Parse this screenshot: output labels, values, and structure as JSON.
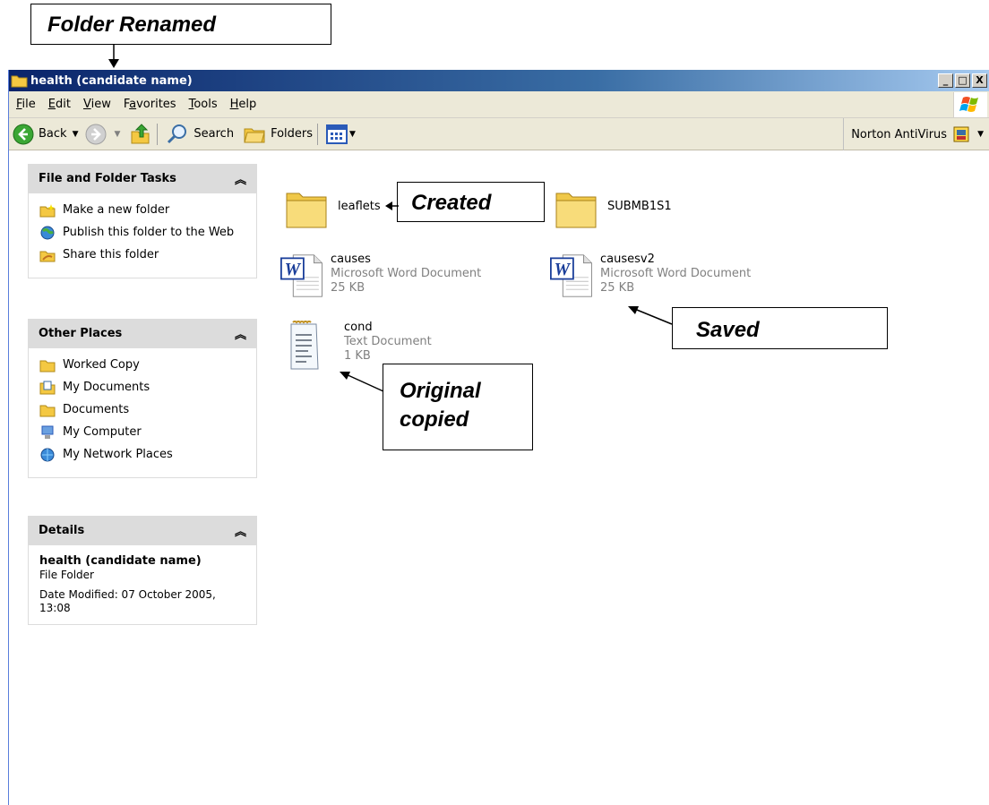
{
  "callouts": {
    "renamed": "Folder Renamed",
    "created": "Created",
    "saved": "Saved",
    "original_line1": "Original",
    "original_line2": "copied"
  },
  "window": {
    "title": "health (candidate name)",
    "buttons": {
      "minimize": "_",
      "maximize": "□",
      "close": "X"
    }
  },
  "menu": [
    {
      "prefix": "",
      "u": "F",
      "rest": "ile"
    },
    {
      "prefix": "",
      "u": "E",
      "rest": "dit"
    },
    {
      "prefix": "",
      "u": "V",
      "rest": "iew"
    },
    {
      "prefix": "F",
      "u": "a",
      "rest": "vorites"
    },
    {
      "prefix": "",
      "u": "T",
      "rest": "ools"
    },
    {
      "prefix": "",
      "u": "H",
      "rest": "elp"
    }
  ],
  "toolbar": {
    "back": "Back",
    "search": "Search",
    "folders": "Folders",
    "norton": "Norton AntiVirus"
  },
  "tasks": {
    "title": "File and Folder Tasks",
    "items": [
      "Make a new folder",
      "Publish this folder to the Web",
      "Share this folder"
    ]
  },
  "places": {
    "title": "Other Places",
    "items": [
      "Worked Copy",
      "My Documents",
      "Documents",
      "My Computer",
      "My Network Places"
    ]
  },
  "details": {
    "title": "Details",
    "name": "health (candidate name)",
    "type": "File Folder",
    "modified": "Date Modified: 07 October 2005, 13:08"
  },
  "files": {
    "leaflets": {
      "name": "leaflets"
    },
    "submb": {
      "name": "SUBMB1S1"
    },
    "causes": {
      "name": "causes",
      "type": "Microsoft Word Document",
      "size": "25 KB"
    },
    "causesv2": {
      "name": "causesv2",
      "type": "Microsoft Word Document",
      "size": "25 KB"
    },
    "cond": {
      "name": "cond",
      "type": "Text Document",
      "size": "1 KB"
    }
  },
  "colors": {
    "titlebar": "#0a246a",
    "chrome": "#ece9d8",
    "panel_header": "#dcdcdc"
  }
}
